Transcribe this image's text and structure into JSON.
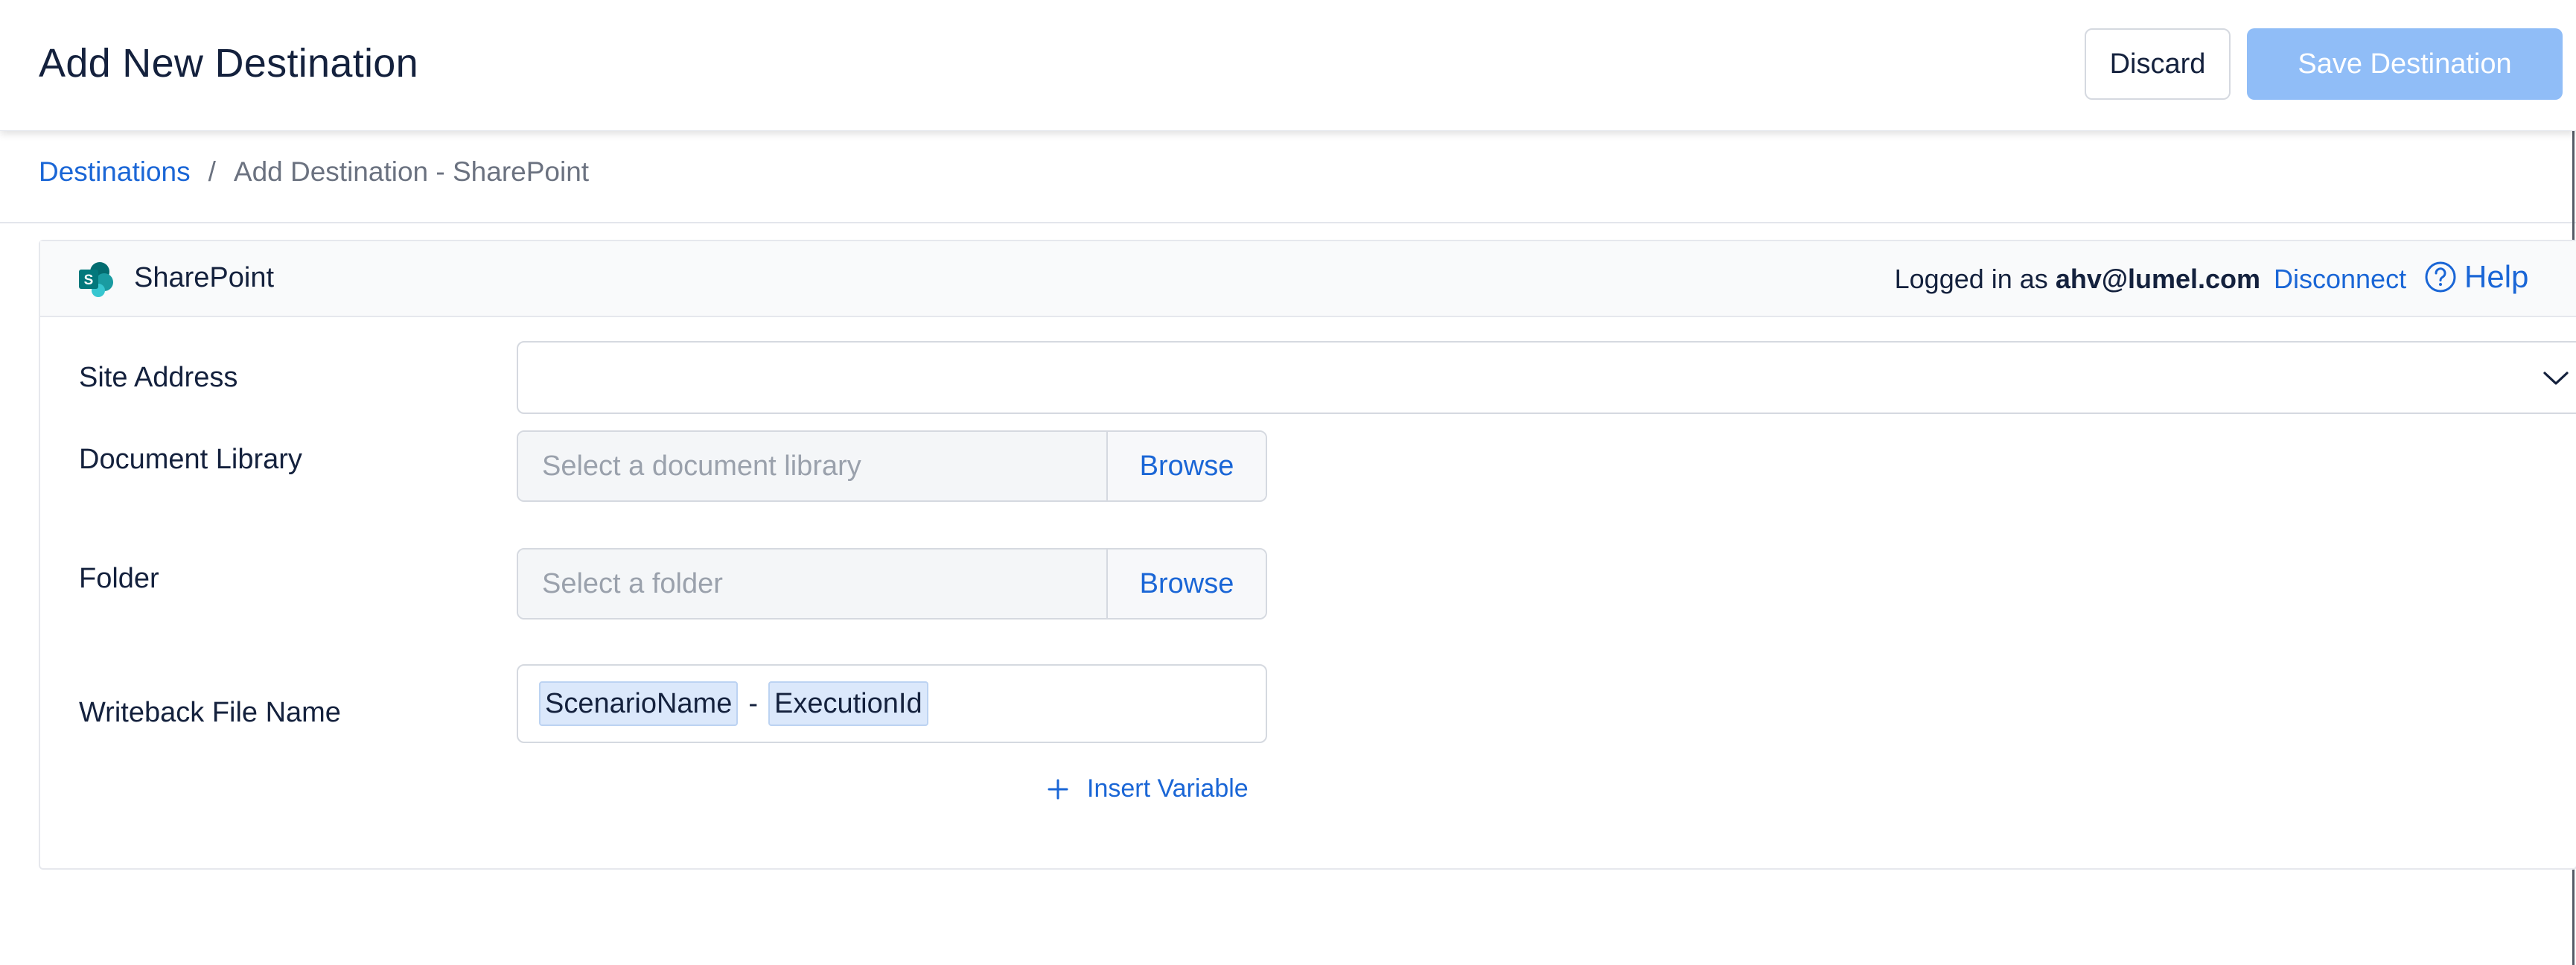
{
  "header": {
    "title": "Add New Destination",
    "discard_label": "Discard",
    "save_label": "Save Destination"
  },
  "breadcrumb": {
    "link": "Destinations",
    "separator": "/",
    "current": "Add Destination - SharePoint"
  },
  "connection": {
    "service_name": "SharePoint",
    "logged_in_prefix": "Logged in as ",
    "user": "ahv@lumel.com",
    "disconnect_label": "Disconnect",
    "help_label": "Help",
    "icons": {
      "logo": "sharepoint-logo",
      "help": "help-circle-icon"
    }
  },
  "form": {
    "site_address": {
      "label": "Site Address",
      "value": ""
    },
    "document_library": {
      "label": "Document Library",
      "placeholder": "Select a document library",
      "browse_label": "Browse"
    },
    "folder": {
      "label": "Folder",
      "placeholder": "Select a folder",
      "browse_label": "Browse"
    },
    "writeback": {
      "label": "Writeback File Name",
      "tokens": [
        "ScenarioName",
        "ExecutionId"
      ],
      "separator": "-"
    },
    "insert_variable_label": "Insert Variable"
  },
  "colors": {
    "accent": "#1a66d6",
    "save_disabled": "#90bdf7",
    "chip_bg": "#dbe8fb"
  }
}
